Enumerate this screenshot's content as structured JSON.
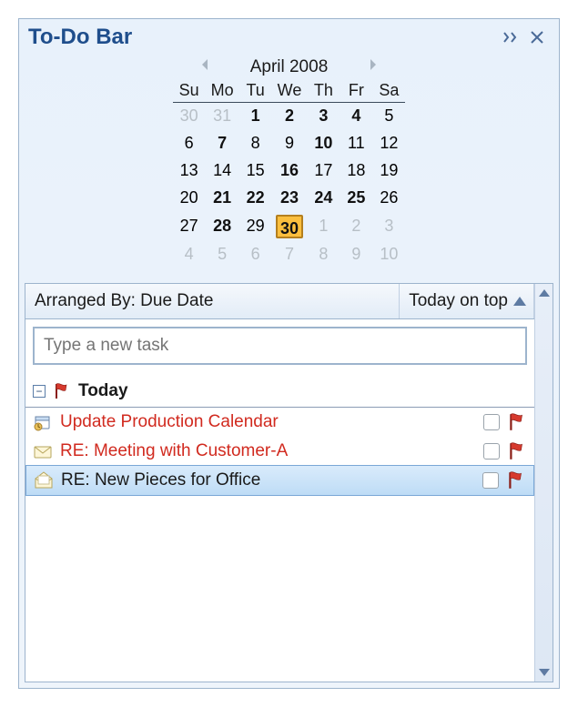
{
  "title": "To-Do Bar",
  "calendar": {
    "month_label": "April 2008",
    "day_headers": [
      "Su",
      "Mo",
      "Tu",
      "We",
      "Th",
      "Fr",
      "Sa"
    ],
    "weeks": [
      [
        {
          "n": "30",
          "dim": true
        },
        {
          "n": "31",
          "dim": true
        },
        {
          "n": "1",
          "b": true
        },
        {
          "n": "2",
          "b": true
        },
        {
          "n": "3",
          "b": true
        },
        {
          "n": "4",
          "b": true
        },
        {
          "n": "5"
        }
      ],
      [
        {
          "n": "6"
        },
        {
          "n": "7",
          "b": true
        },
        {
          "n": "8"
        },
        {
          "n": "9"
        },
        {
          "n": "10",
          "b": true
        },
        {
          "n": "11"
        },
        {
          "n": "12"
        }
      ],
      [
        {
          "n": "13"
        },
        {
          "n": "14"
        },
        {
          "n": "15"
        },
        {
          "n": "16",
          "b": true
        },
        {
          "n": "17"
        },
        {
          "n": "18"
        },
        {
          "n": "19"
        }
      ],
      [
        {
          "n": "20"
        },
        {
          "n": "21",
          "b": true
        },
        {
          "n": "22",
          "b": true
        },
        {
          "n": "23",
          "b": true
        },
        {
          "n": "24",
          "b": true
        },
        {
          "n": "25",
          "b": true
        },
        {
          "n": "26"
        }
      ],
      [
        {
          "n": "27"
        },
        {
          "n": "28",
          "b": true
        },
        {
          "n": "29"
        },
        {
          "n": "30",
          "b": true,
          "today": true
        },
        {
          "n": "1",
          "dim": true
        },
        {
          "n": "2",
          "dim": true
        },
        {
          "n": "3",
          "dim": true
        }
      ],
      [
        {
          "n": "4",
          "dim": true
        },
        {
          "n": "5",
          "dim": true
        },
        {
          "n": "6",
          "dim": true
        },
        {
          "n": "7",
          "dim": true
        },
        {
          "n": "8",
          "dim": true
        },
        {
          "n": "9",
          "dim": true
        },
        {
          "n": "10",
          "dim": true
        }
      ]
    ]
  },
  "arrange": {
    "left": "Arranged By: Due Date",
    "right": "Today on top"
  },
  "new_task_placeholder": "Type a new task",
  "group": {
    "label": "Today"
  },
  "tasks": [
    {
      "icon": "calendar-task-icon",
      "text": "Update Production Calendar",
      "red": true,
      "selected": false
    },
    {
      "icon": "mail-icon",
      "text": "RE: Meeting with Customer-A",
      "red": true,
      "selected": false
    },
    {
      "icon": "mail-open-icon",
      "text": "RE: New Pieces for Office",
      "red": false,
      "selected": true
    }
  ]
}
